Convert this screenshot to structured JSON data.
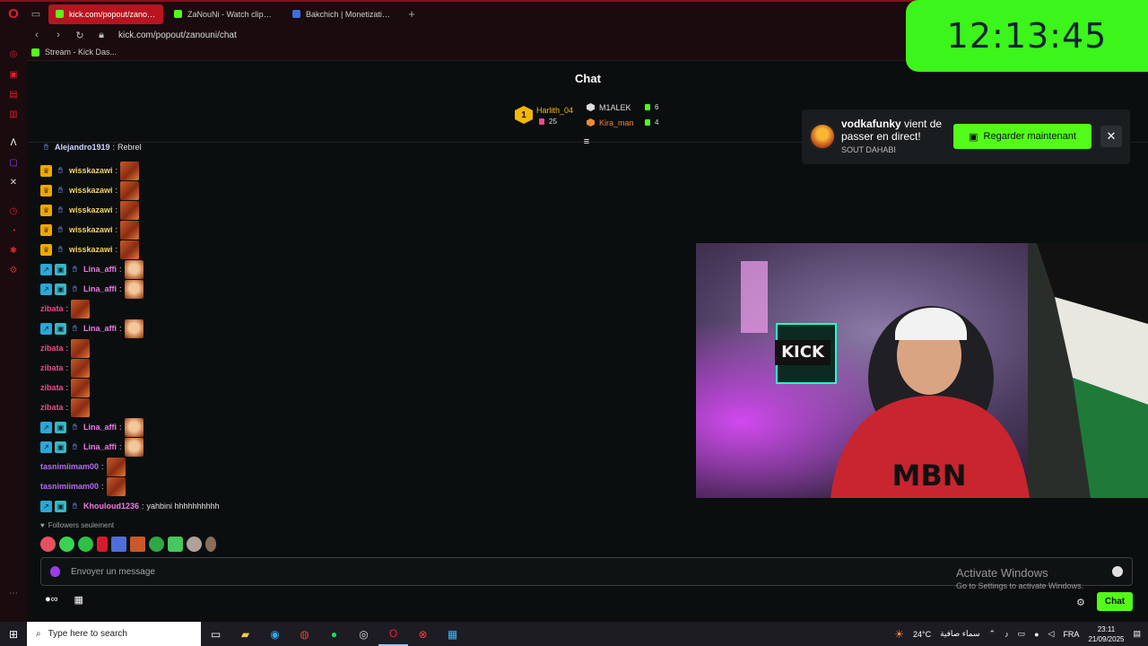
{
  "browser": {
    "tabs": [
      {
        "label": "kick.com/popout/zanouni",
        "active": true,
        "favicon": "kick"
      },
      {
        "label": "ZaNouNi - Watch clips on",
        "active": false,
        "favicon": "kick"
      },
      {
        "label": "Bakchich | Monetization f",
        "active": false,
        "favicon": "bak"
      }
    ],
    "url": "kick.com/popout/zanouni/chat",
    "bookmark": "Stream - Kick Das..."
  },
  "clock": "12:13:45",
  "chat": {
    "title": "Chat",
    "leaderboard": [
      {
        "rank": "1",
        "name": "Harlith_04",
        "count": "25"
      },
      {
        "rank": "2",
        "name": "M1ALEK",
        "count": "6"
      },
      {
        "rank": "3",
        "name": "Kira_man",
        "count": "4"
      }
    ],
    "messages": [
      {
        "user": "Alejandro1919",
        "text": "Rebrel",
        "badges": [
          "hand"
        ],
        "color": "#cfd6ff",
        "emote": ""
      },
      {
        "user": "wisskazawi",
        "text": "",
        "badges": [
          "crown",
          "hand"
        ],
        "color": "#f2d36b",
        "emote": "red"
      },
      {
        "user": "wisskazawi",
        "text": "",
        "badges": [
          "crown",
          "hand"
        ],
        "color": "#f2d36b",
        "emote": "red"
      },
      {
        "user": "wisskazawi",
        "text": "",
        "badges": [
          "crown",
          "hand"
        ],
        "color": "#f2d36b",
        "emote": "red"
      },
      {
        "user": "wisskazawi",
        "text": "",
        "badges": [
          "crown",
          "hand"
        ],
        "color": "#f2d36b",
        "emote": "red"
      },
      {
        "user": "wisskazawi",
        "text": "",
        "badges": [
          "crown",
          "hand"
        ],
        "color": "#f2d36b",
        "emote": "red"
      },
      {
        "user": "Lina_affi",
        "text": "",
        "badges": [
          "verified",
          "sub",
          "hand"
        ],
        "color": "#ee7ae6",
        "emote": "face"
      },
      {
        "user": "Lina_affi",
        "text": "",
        "badges": [
          "verified",
          "sub",
          "hand"
        ],
        "color": "#ee7ae6",
        "emote": "face"
      },
      {
        "user": "zibata",
        "text": "",
        "badges": [],
        "color": "#f04a8a",
        "emote": "red"
      },
      {
        "user": "Lina_affi",
        "text": "",
        "badges": [
          "verified",
          "sub",
          "hand"
        ],
        "color": "#ee7ae6",
        "emote": "face"
      },
      {
        "user": "zibata",
        "text": "",
        "badges": [],
        "color": "#f04a8a",
        "emote": "red"
      },
      {
        "user": "zibata",
        "text": "",
        "badges": [],
        "color": "#f04a8a",
        "emote": "red"
      },
      {
        "user": "zibata",
        "text": "",
        "badges": [],
        "color": "#f04a8a",
        "emote": "red"
      },
      {
        "user": "zibata",
        "text": "",
        "badges": [],
        "color": "#f04a8a",
        "emote": "red"
      },
      {
        "user": "Lina_affi",
        "text": "",
        "badges": [
          "verified",
          "sub",
          "hand"
        ],
        "color": "#ee7ae6",
        "emote": "face"
      },
      {
        "user": "Lina_affi",
        "text": "",
        "badges": [
          "verified",
          "sub",
          "hand"
        ],
        "color": "#ee7ae6",
        "emote": "face"
      },
      {
        "user": "tasnimiimam00",
        "text": "",
        "badges": [],
        "color": "#b46cf2",
        "emote": "red"
      },
      {
        "user": "tasnimiimam00",
        "text": "",
        "badges": [],
        "color": "#b46cf2",
        "emote": "red"
      },
      {
        "user": "Khouloud1236",
        "text": "yahbini hhhhhhhhhh",
        "badges": [
          "verified",
          "sub",
          "hand"
        ],
        "color": "#ee7ae6",
        "emote": ""
      }
    ],
    "followers_only": "Followers seulement",
    "input_placeholder": "Envoyer un message",
    "send_label": "Chat"
  },
  "notification": {
    "streamer": "vodkafunky",
    "text": " vient de passer en direct!",
    "subtitle": "SOUT DAHABI",
    "watch_label": "Regarder maintenant"
  },
  "activate_windows": {
    "title": "Activate Windows",
    "subtitle": "Go to Settings to activate Windows."
  },
  "taskbar": {
    "search_placeholder": "Type here to search",
    "weather": "24°C",
    "weather_text": "سماء صافية",
    "language": "FRA",
    "time": "23:11",
    "date": "21/09/2025"
  },
  "colors": {
    "kick_green": "#53fc18",
    "clock_green": "#3cf51a",
    "opera_red": "#b8141f"
  }
}
